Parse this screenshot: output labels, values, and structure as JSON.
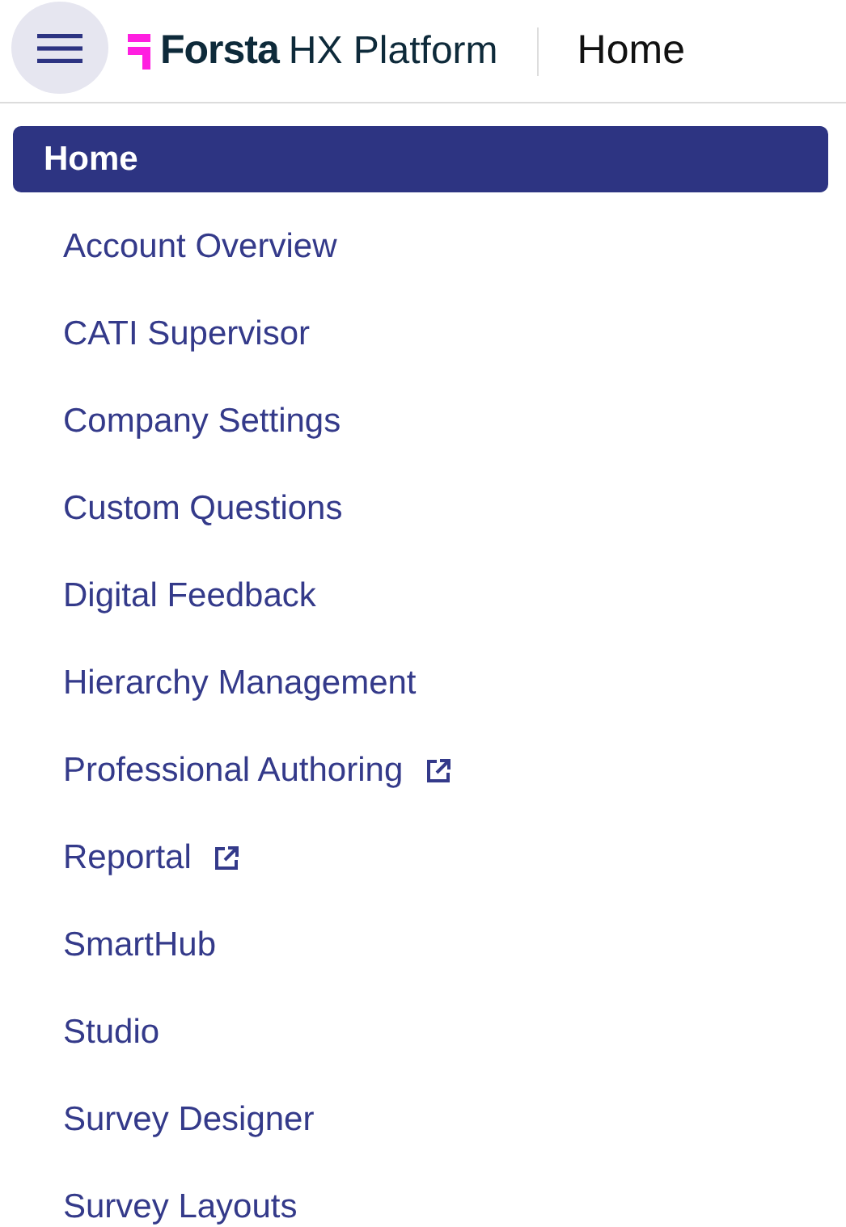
{
  "header": {
    "brand": "Forsta",
    "product": "HX Platform",
    "page_title": "Home"
  },
  "menu": [
    {
      "label": "Home",
      "selected": true,
      "external": false
    },
    {
      "label": "Account Overview",
      "selected": false,
      "external": false
    },
    {
      "label": "CATI Supervisor",
      "selected": false,
      "external": false
    },
    {
      "label": "Company Settings",
      "selected": false,
      "external": false
    },
    {
      "label": "Custom Questions",
      "selected": false,
      "external": false
    },
    {
      "label": "Digital Feedback",
      "selected": false,
      "external": false
    },
    {
      "label": "Hierarchy Management",
      "selected": false,
      "external": false
    },
    {
      "label": "Professional Authoring",
      "selected": false,
      "external": true
    },
    {
      "label": "Reportal",
      "selected": false,
      "external": true
    },
    {
      "label": "SmartHub",
      "selected": false,
      "external": false
    },
    {
      "label": "Studio",
      "selected": false,
      "external": false
    },
    {
      "label": "Survey Designer",
      "selected": false,
      "external": false
    },
    {
      "label": "Survey Layouts",
      "selected": false,
      "external": false
    }
  ]
}
